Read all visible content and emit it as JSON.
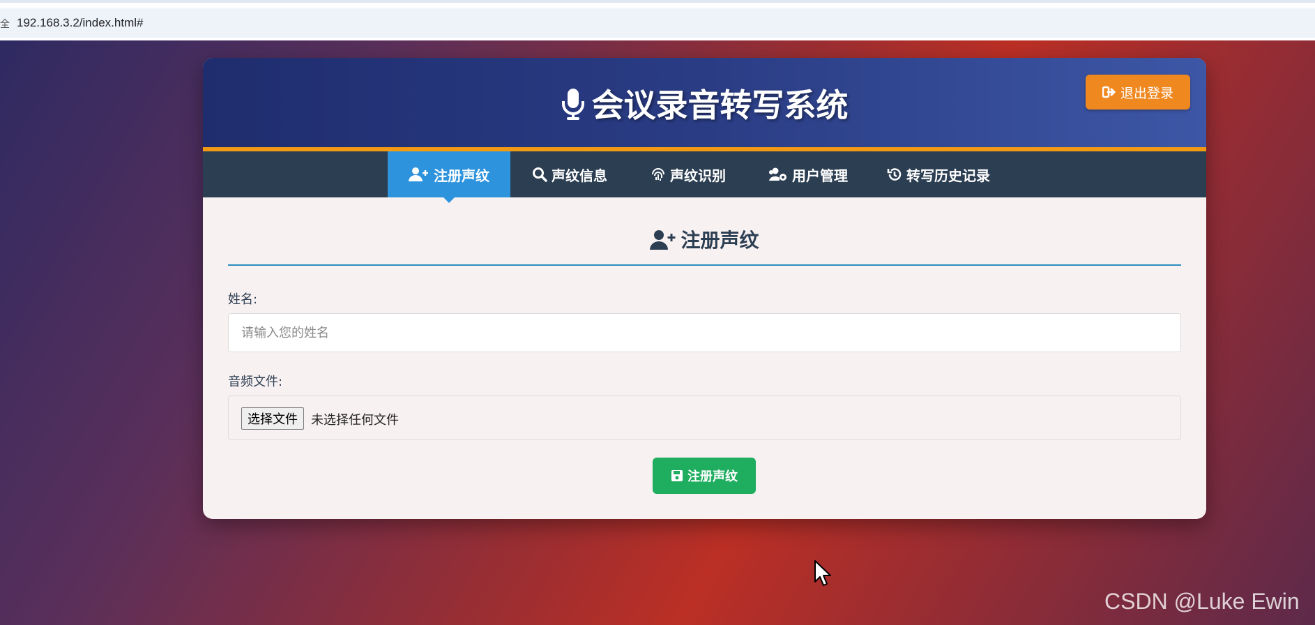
{
  "browser": {
    "url": "192.168.3.2/index.html#",
    "lock_glyph": "全"
  },
  "header": {
    "title": "会议录音转写系统",
    "logout_label": "退出登录"
  },
  "nav": {
    "tabs": [
      {
        "label": "注册声纹",
        "icon": "user-plus-icon",
        "active": true
      },
      {
        "label": "声纹信息",
        "icon": "search-icon",
        "active": false
      },
      {
        "label": "声纹识别",
        "icon": "fingerprint-icon",
        "active": false
      },
      {
        "label": "用户管理",
        "icon": "users-cog-icon",
        "active": false
      },
      {
        "label": "转写历史记录",
        "icon": "history-icon",
        "active": false
      }
    ]
  },
  "form": {
    "section_title": "注册声纹",
    "name_label": "姓名:",
    "name_placeholder": "请输入您的姓名",
    "audio_label": "音频文件:",
    "file_button": "选择文件",
    "file_status": "未选择任何文件",
    "submit_label": "注册声纹"
  },
  "watermark": "CSDN @Luke Ewin",
  "colors": {
    "header_start": "#1f2d6e",
    "header_accent": "#f39a14",
    "nav_bg": "#2c3e52",
    "nav_active": "#2e93dd",
    "logout": "#f08820",
    "submit": "#1fae5f"
  }
}
